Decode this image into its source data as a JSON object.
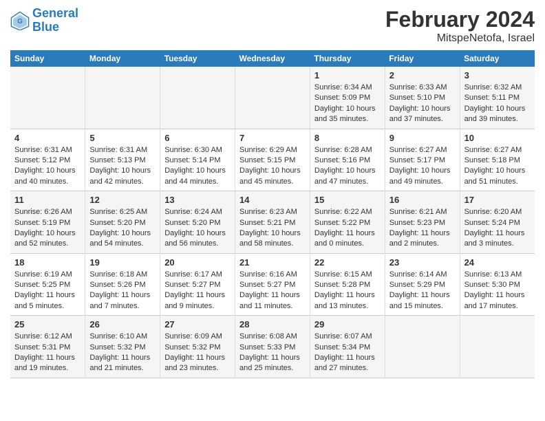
{
  "header": {
    "logo_line1": "General",
    "logo_line2": "Blue",
    "title": "February 2024",
    "subtitle": "MitspeNetofa, Israel"
  },
  "weekdays": [
    "Sunday",
    "Monday",
    "Tuesday",
    "Wednesday",
    "Thursday",
    "Friday",
    "Saturday"
  ],
  "weeks": [
    {
      "days": [
        {
          "num": "",
          "info": ""
        },
        {
          "num": "",
          "info": ""
        },
        {
          "num": "",
          "info": ""
        },
        {
          "num": "",
          "info": ""
        },
        {
          "num": "1",
          "info": "Sunrise: 6:34 AM\nSunset: 5:09 PM\nDaylight: 10 hours\nand 35 minutes."
        },
        {
          "num": "2",
          "info": "Sunrise: 6:33 AM\nSunset: 5:10 PM\nDaylight: 10 hours\nand 37 minutes."
        },
        {
          "num": "3",
          "info": "Sunrise: 6:32 AM\nSunset: 5:11 PM\nDaylight: 10 hours\nand 39 minutes."
        }
      ]
    },
    {
      "days": [
        {
          "num": "4",
          "info": "Sunrise: 6:31 AM\nSunset: 5:12 PM\nDaylight: 10 hours\nand 40 minutes."
        },
        {
          "num": "5",
          "info": "Sunrise: 6:31 AM\nSunset: 5:13 PM\nDaylight: 10 hours\nand 42 minutes."
        },
        {
          "num": "6",
          "info": "Sunrise: 6:30 AM\nSunset: 5:14 PM\nDaylight: 10 hours\nand 44 minutes."
        },
        {
          "num": "7",
          "info": "Sunrise: 6:29 AM\nSunset: 5:15 PM\nDaylight: 10 hours\nand 45 minutes."
        },
        {
          "num": "8",
          "info": "Sunrise: 6:28 AM\nSunset: 5:16 PM\nDaylight: 10 hours\nand 47 minutes."
        },
        {
          "num": "9",
          "info": "Sunrise: 6:27 AM\nSunset: 5:17 PM\nDaylight: 10 hours\nand 49 minutes."
        },
        {
          "num": "10",
          "info": "Sunrise: 6:27 AM\nSunset: 5:18 PM\nDaylight: 10 hours\nand 51 minutes."
        }
      ]
    },
    {
      "days": [
        {
          "num": "11",
          "info": "Sunrise: 6:26 AM\nSunset: 5:19 PM\nDaylight: 10 hours\nand 52 minutes."
        },
        {
          "num": "12",
          "info": "Sunrise: 6:25 AM\nSunset: 5:20 PM\nDaylight: 10 hours\nand 54 minutes."
        },
        {
          "num": "13",
          "info": "Sunrise: 6:24 AM\nSunset: 5:20 PM\nDaylight: 10 hours\nand 56 minutes."
        },
        {
          "num": "14",
          "info": "Sunrise: 6:23 AM\nSunset: 5:21 PM\nDaylight: 10 hours\nand 58 minutes."
        },
        {
          "num": "15",
          "info": "Sunrise: 6:22 AM\nSunset: 5:22 PM\nDaylight: 11 hours\nand 0 minutes."
        },
        {
          "num": "16",
          "info": "Sunrise: 6:21 AM\nSunset: 5:23 PM\nDaylight: 11 hours\nand 2 minutes."
        },
        {
          "num": "17",
          "info": "Sunrise: 6:20 AM\nSunset: 5:24 PM\nDaylight: 11 hours\nand 3 minutes."
        }
      ]
    },
    {
      "days": [
        {
          "num": "18",
          "info": "Sunrise: 6:19 AM\nSunset: 5:25 PM\nDaylight: 11 hours\nand 5 minutes."
        },
        {
          "num": "19",
          "info": "Sunrise: 6:18 AM\nSunset: 5:26 PM\nDaylight: 11 hours\nand 7 minutes."
        },
        {
          "num": "20",
          "info": "Sunrise: 6:17 AM\nSunset: 5:27 PM\nDaylight: 11 hours\nand 9 minutes."
        },
        {
          "num": "21",
          "info": "Sunrise: 6:16 AM\nSunset: 5:27 PM\nDaylight: 11 hours\nand 11 minutes."
        },
        {
          "num": "22",
          "info": "Sunrise: 6:15 AM\nSunset: 5:28 PM\nDaylight: 11 hours\nand 13 minutes."
        },
        {
          "num": "23",
          "info": "Sunrise: 6:14 AM\nSunset: 5:29 PM\nDaylight: 11 hours\nand 15 minutes."
        },
        {
          "num": "24",
          "info": "Sunrise: 6:13 AM\nSunset: 5:30 PM\nDaylight: 11 hours\nand 17 minutes."
        }
      ]
    },
    {
      "days": [
        {
          "num": "25",
          "info": "Sunrise: 6:12 AM\nSunset: 5:31 PM\nDaylight: 11 hours\nand 19 minutes."
        },
        {
          "num": "26",
          "info": "Sunrise: 6:10 AM\nSunset: 5:32 PM\nDaylight: 11 hours\nand 21 minutes."
        },
        {
          "num": "27",
          "info": "Sunrise: 6:09 AM\nSunset: 5:32 PM\nDaylight: 11 hours\nand 23 minutes."
        },
        {
          "num": "28",
          "info": "Sunrise: 6:08 AM\nSunset: 5:33 PM\nDaylight: 11 hours\nand 25 minutes."
        },
        {
          "num": "29",
          "info": "Sunrise: 6:07 AM\nSunset: 5:34 PM\nDaylight: 11 hours\nand 27 minutes."
        },
        {
          "num": "",
          "info": ""
        },
        {
          "num": "",
          "info": ""
        }
      ]
    }
  ]
}
